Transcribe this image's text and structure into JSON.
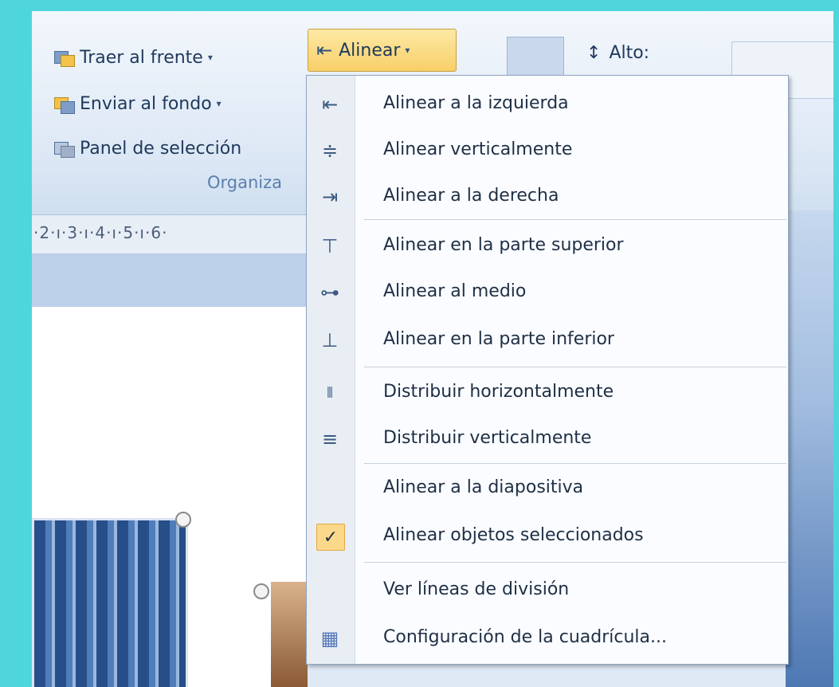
{
  "ribbon": {
    "traer_label": "Traer al frente",
    "enviar_label": "Enviar al fondo",
    "panel_label": "Panel de selección",
    "group_label": "Organiza",
    "alinear_label": "Alinear",
    "alto_label": "Alto:"
  },
  "ruler": {
    "text": "·2·ı·3·ı·4·ı·5·ı·6·"
  },
  "menu": {
    "items": [
      {
        "label": "Alinear a la izquierda",
        "icon": "align-left-icon",
        "glyph": "⇤"
      },
      {
        "label": "Alinear verticalmente",
        "icon": "align-center-icon",
        "glyph": "≑"
      },
      {
        "label": "Alinear a la derecha",
        "icon": "align-right-icon",
        "glyph": "⇥"
      },
      {
        "label": "Alinear en la parte superior",
        "icon": "align-top-icon",
        "glyph": "⊤"
      },
      {
        "label": "Alinear al medio",
        "icon": "align-middle-icon",
        "glyph": "⊶"
      },
      {
        "label": "Alinear en la parte inferior",
        "icon": "align-bottom-icon",
        "glyph": "⊥"
      },
      {
        "label": "Distribuir horizontalmente",
        "icon": "distribute-horizontal-icon",
        "glyph": "⫴"
      },
      {
        "label": "Distribuir verticalmente",
        "icon": "distribute-vertical-icon",
        "glyph": "≡"
      },
      {
        "label": "Alinear a la diapositiva",
        "icon": "",
        "glyph": ""
      },
      {
        "label": "Alinear objetos seleccionados",
        "icon": "checkmark-icon",
        "glyph": "✓",
        "checked": true
      },
      {
        "label": "Ver líneas de división",
        "icon": "",
        "glyph": ""
      },
      {
        "label": "Configuración de la cuadrícula...",
        "icon": "grid-icon",
        "glyph": "▦"
      }
    ]
  }
}
